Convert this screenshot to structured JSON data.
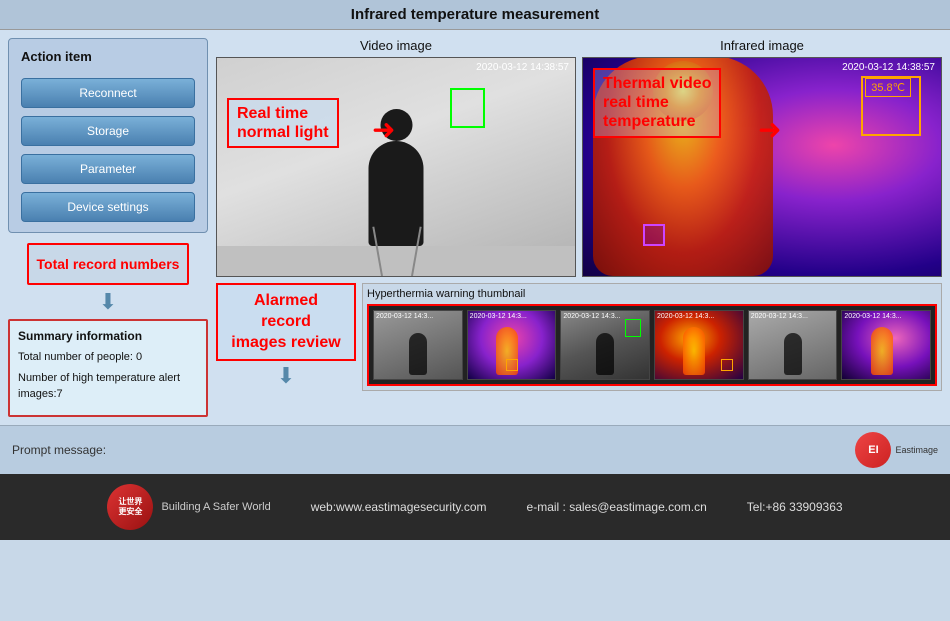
{
  "title": "Infrared temperature measurement",
  "left_panel": {
    "action_label": "Action item",
    "buttons": [
      "Reconnect",
      "Storage",
      "Parameter",
      "Device settings"
    ],
    "record_label": "Total record numbers",
    "summary_title": "Summary information",
    "summary_total": "Total number of people:  0",
    "summary_alert": "Number of high temperature alert images:7"
  },
  "video": {
    "left_label": "Video image",
    "right_label": "Infrared image",
    "timestamp_left": "2020-03-12 14:38:57",
    "timestamp_right": "2020-03-12 14:38:57",
    "annotation_normal": "Real time\nnormal light",
    "annotation_thermal": "Thermal video\nreal time\ntemperature",
    "temp_value": "35.8℃"
  },
  "alarmed": {
    "label": "Alarmed record\nimages review"
  },
  "thumbnails": {
    "label": "Hyperthermia warning thumbnail",
    "timestamps": [
      "2020-03-12 14:3...",
      "2020-03-12 14:3...",
      "2020-03-12 14:3...",
      "2020-03-12 14:3...",
      "2020-03-12 14:3...",
      "2020-03-12 14:3..."
    ]
  },
  "prompt": {
    "label": "Prompt message:"
  },
  "footer": {
    "web": "web:www.eastimagesecurity.com",
    "email": "e-mail : sales@eastimage.com.cn",
    "tel": "Tel:+86 33909363",
    "logo_text": "让世界更安全",
    "logo_sub": "Building A Safer World"
  }
}
